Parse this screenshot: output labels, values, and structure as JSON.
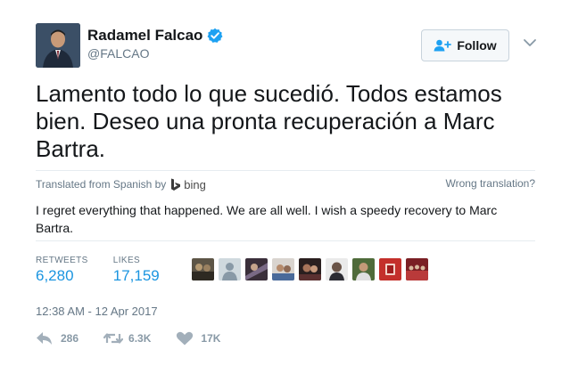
{
  "author": {
    "display_name": "Radamel Falcao",
    "handle": "@FALCAO",
    "verified": true
  },
  "follow_button": {
    "label": "Follow"
  },
  "tweet": {
    "text": "Lamento todo lo que sucedió. Todos estamos bien. Deseo una pronta recuperación a Marc Bartra."
  },
  "translation_bar": {
    "prefix": "Translated from Spanish by",
    "provider": "bing",
    "wrong_link": "Wrong translation?"
  },
  "translation": {
    "text": "I regret everything that happened. We are all well. I wish a speedy recovery to Marc Bartra."
  },
  "stats": {
    "retweets_label": "RETWEETS",
    "retweets_value": "6,280",
    "likes_label": "LIKES",
    "likes_value": "17,159"
  },
  "timestamp": "12:38 AM - 12 Apr 2017",
  "actions": {
    "reply_count": "286",
    "retweet_count": "6.3K",
    "like_count": "17K"
  },
  "colors": {
    "accent": "#1b95e0",
    "muted": "#657786",
    "action_gray": "#8899a6",
    "divider": "#e6ecf0"
  },
  "icons": [
    "verified-icon",
    "follow-user-icon",
    "caret-down-icon",
    "bing-icon",
    "reply-icon",
    "retweet-icon",
    "heart-icon"
  ]
}
